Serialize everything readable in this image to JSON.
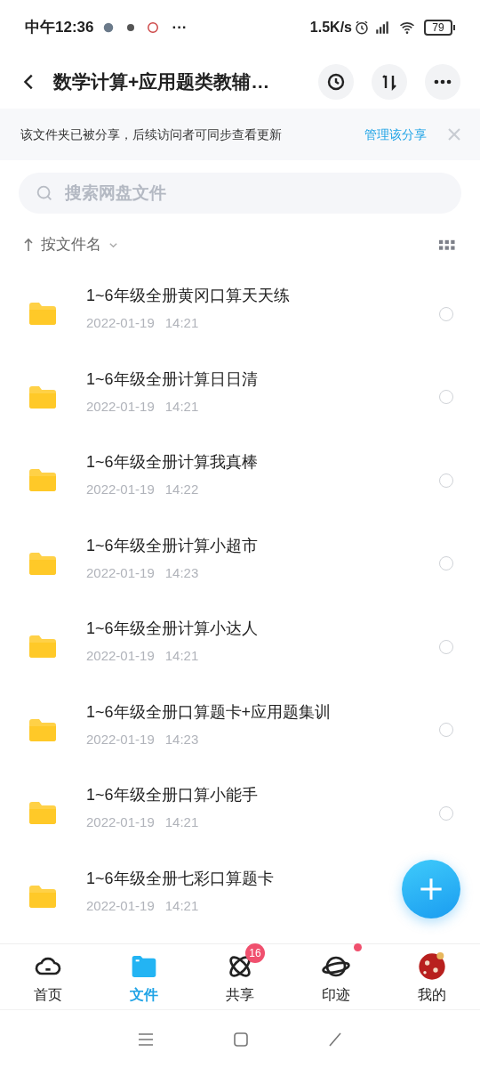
{
  "status_bar": {
    "time": "中午12:36",
    "more": "···",
    "speed": "1.5K/s",
    "battery": "79"
  },
  "header": {
    "title": "数学计算+应用题类教辅…"
  },
  "share_banner": {
    "message": "该文件夹已被分享，后续访问者可同步查看更新",
    "link": "管理该分享"
  },
  "search": {
    "placeholder": "搜索网盘文件"
  },
  "sort": {
    "label": "按文件名"
  },
  "files": [
    {
      "name": "1~6年级全册黄冈口算天天练",
      "date": "2022-01-19",
      "time": "14:21",
      "selected": false
    },
    {
      "name": "1~6年级全册计算日日清",
      "date": "2022-01-19",
      "time": "14:21",
      "selected": false
    },
    {
      "name": "1~6年级全册计算我真棒",
      "date": "2022-01-19",
      "time": "14:22",
      "selected": false
    },
    {
      "name": "1~6年级全册计算小超市",
      "date": "2022-01-19",
      "time": "14:23",
      "selected": false
    },
    {
      "name": "1~6年级全册计算小达人",
      "date": "2022-01-19",
      "time": "14:21",
      "selected": false
    },
    {
      "name": "1~6年级全册口算题卡+应用题集训",
      "date": "2022-01-19",
      "time": "14:23",
      "selected": false
    },
    {
      "name": "1~6年级全册口算小能手",
      "date": "2022-01-19",
      "time": "14:21",
      "selected": false
    },
    {
      "name": "1~6年级全册七彩口算题卡",
      "date": "2022-01-19",
      "time": "14:21"
    }
  ],
  "tabs": [
    {
      "label": "首页",
      "kind": "cloud",
      "selected": false
    },
    {
      "label": "文件",
      "kind": "folder",
      "selected": true
    },
    {
      "label": "共享",
      "kind": "atom",
      "selected": false,
      "badge": "16"
    },
    {
      "label": "印迹",
      "kind": "planet",
      "selected": false,
      "dot": true
    },
    {
      "label": "我的",
      "kind": "avatar",
      "selected": false
    }
  ]
}
